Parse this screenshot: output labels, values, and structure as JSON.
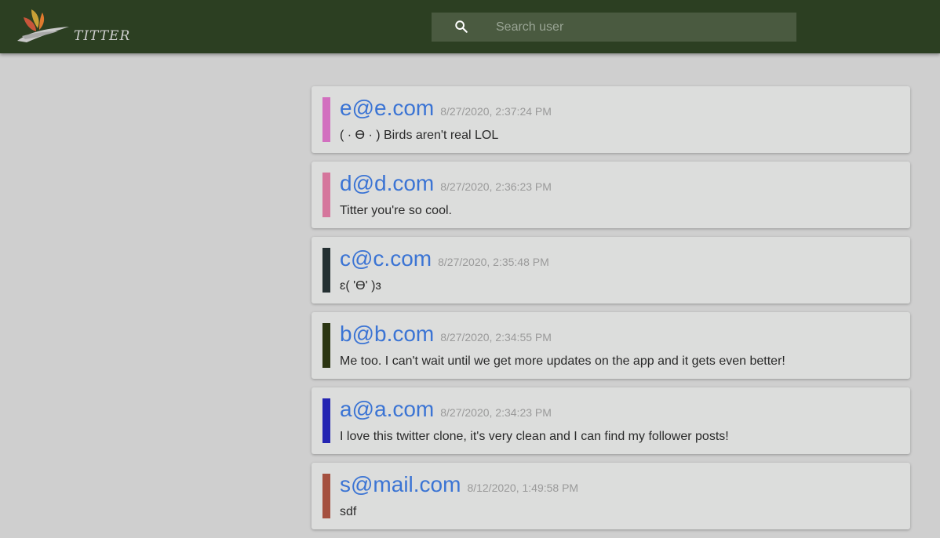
{
  "header": {
    "logo_text": "TITTER",
    "search": {
      "placeholder": "Search user",
      "value": ""
    }
  },
  "posts": [
    {
      "user": "e@e.com",
      "timestamp": "8/27/2020, 2:37:24 PM",
      "text": "( · ϴ · ) Birds aren't real LOL",
      "color": "#d26fbf"
    },
    {
      "user": "d@d.com",
      "timestamp": "8/27/2020, 2:36:23 PM",
      "text": "Titter you're so cool.",
      "color": "#d5769c"
    },
    {
      "user": "c@c.com",
      "timestamp": "8/27/2020, 2:35:48 PM",
      "text": "ɛ( 'ϴ' )ɜ",
      "color": "#243032"
    },
    {
      "user": "b@b.com",
      "timestamp": "8/27/2020, 2:34:55 PM",
      "text": "Me too. I can't wait until we get more updates on the app and it gets even better!",
      "color": "#2b3512"
    },
    {
      "user": "a@a.com",
      "timestamp": "8/27/2020, 2:34:23 PM",
      "text": "I love this twitter clone, it's very clean and I can find my follower posts!",
      "color": "#2424b2"
    },
    {
      "user": "s@mail.com",
      "timestamp": "8/12/2020, 1:49:58 PM",
      "text": "sdf",
      "color": "#a4503f"
    }
  ]
}
